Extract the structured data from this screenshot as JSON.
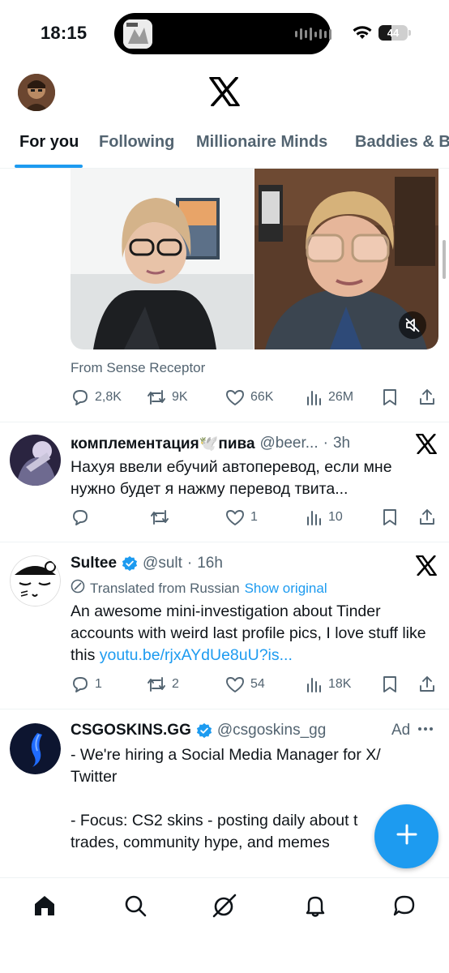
{
  "status_bar": {
    "time": "18:15",
    "battery": "44",
    "battery_level": 0.44
  },
  "tabs": [
    "For you",
    "Following",
    "Millionaire Minds",
    "Baddies & B"
  ],
  "media_tweet": {
    "source": "From Sense Receptor",
    "replies": "2,8K",
    "reposts": "9K",
    "likes": "66K",
    "views": "26M"
  },
  "tweets": [
    {
      "name": "комплементация🕊️пива",
      "handle": "@beer...",
      "time": "3h",
      "text": "Нахуя ввели ебучий автоперевод, если мне нужно будет я нажму перевод твита...",
      "replies": "",
      "reposts": "",
      "likes": "1",
      "views": "10"
    },
    {
      "name": "Sultee",
      "handle": "@sult",
      "time": "16h",
      "translated_label": "Translated from Russian",
      "show_original": "Show original",
      "text": "An awesome mini-investigation about Tinder accounts with weird last profile pics, I love stuff like this",
      "link": "youtu.be/rjxAYdUe8uU?is...",
      "replies": "1",
      "reposts": "2",
      "likes": "54",
      "views": "18K"
    },
    {
      "name": "CSGOSKINS.GG",
      "handle": "@csgoskins_gg",
      "ad_label": "Ad",
      "line1": "- We're hiring a Social Media Manager for X/",
      "line2": "Twitter",
      "line3": "- Focus: CS2 skins - posting daily about t",
      "line4": "trades, community hype, and memes"
    }
  ],
  "icons": {
    "header_logo": "x-logo-icon",
    "fab": "plus-icon",
    "nav": [
      "home-icon",
      "search-icon",
      "grok-icon",
      "notifications-icon",
      "messages-icon"
    ]
  },
  "colors": {
    "accent": "#1d9bf0",
    "text": "#0f1419",
    "muted": "#536471",
    "divider": "#eff3f4"
  }
}
